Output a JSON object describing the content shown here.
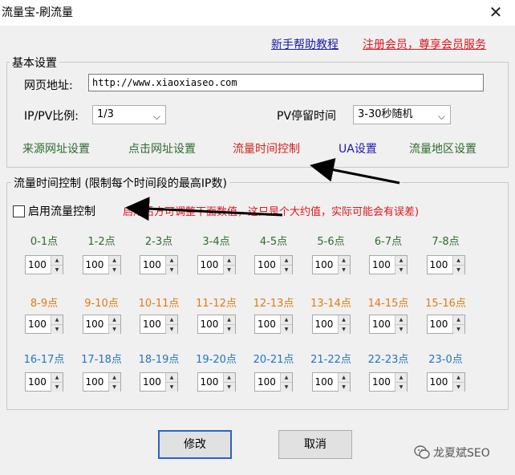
{
  "window": {
    "title": "流量宝-刷流量",
    "close_glyph": "✕"
  },
  "links": {
    "help": "新手帮助教程",
    "register": "注册会员，尊享会员服务"
  },
  "basic": {
    "title": "基本设置",
    "url_label": "网页地址:",
    "url_value": "http://www.xiaoxiaseo.com",
    "ratio_label": "IP/PV比例:",
    "ratio_value": "1/3",
    "stay_label": "PV停留时间",
    "stay_value": "3-30秒随机",
    "funcs": [
      "来源网址设置",
      "点击网址设置",
      "流量时间控制",
      "UA设置",
      "流量地区设置"
    ]
  },
  "flow": {
    "title": "流量时间控制 (限制每个时间段的最高IP数)",
    "enable_label": "启用流量控制",
    "enable_checked": false,
    "note": "启用后方可调整下面数值，这只是个大约值，实际可能会有误差)",
    "slots": [
      {
        "label": "0-1点",
        "value": "100"
      },
      {
        "label": "1-2点",
        "value": "100"
      },
      {
        "label": "2-3点",
        "value": "100"
      },
      {
        "label": "3-4点",
        "value": "100"
      },
      {
        "label": "4-5点",
        "value": "100"
      },
      {
        "label": "5-6点",
        "value": "100"
      },
      {
        "label": "6-7点",
        "value": "100"
      },
      {
        "label": "7-8点",
        "value": "100"
      },
      {
        "label": "8-9点",
        "value": "100"
      },
      {
        "label": "9-10点",
        "value": "100"
      },
      {
        "label": "10-11点",
        "value": "100"
      },
      {
        "label": "11-12点",
        "value": "100"
      },
      {
        "label": "12-13点",
        "value": "100"
      },
      {
        "label": "13-14点",
        "value": "100"
      },
      {
        "label": "14-15点",
        "value": "100"
      },
      {
        "label": "15-16点",
        "value": "100"
      },
      {
        "label": "16-17点",
        "value": "100"
      },
      {
        "label": "17-18点",
        "value": "100"
      },
      {
        "label": "18-19点",
        "value": "100"
      },
      {
        "label": "19-20点",
        "value": "100"
      },
      {
        "label": "20-21点",
        "value": "100"
      },
      {
        "label": "21-22点",
        "value": "100"
      },
      {
        "label": "22-23点",
        "value": "100"
      },
      {
        "label": "23-0点",
        "value": "100"
      }
    ]
  },
  "buttons": {
    "modify": "修改",
    "cancel": "取消"
  },
  "watermark": {
    "text": "龙夏斌SEO",
    "icon": "wechat-icon"
  },
  "icons": {
    "chevron": "chevron-down-icon",
    "spin_up": "▲",
    "spin_down": "▼"
  },
  "colors": {
    "green": "#2f6b2f",
    "red": "#e0141e",
    "blue": "#1a1aa8",
    "orange": "#e07b17",
    "light_blue": "#2474c8"
  }
}
